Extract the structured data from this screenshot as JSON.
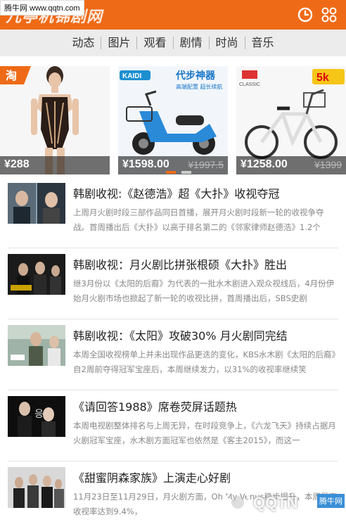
{
  "header": {
    "site_badge": "腾牛网 www.qqtn.com",
    "logo_text": "几亭机锦剧网",
    "clock_icon": "clock-icon",
    "apps_icon": "apps-grid-icon"
  },
  "nav": {
    "items": [
      "动态",
      "图片",
      "观看",
      "剧情",
      "时尚",
      "音乐"
    ]
  },
  "banner": {
    "tao_label": "淘",
    "slides": [
      {
        "price": "¥288",
        "old_price": ""
      },
      {
        "price": "¥1598.00",
        "old_price": "¥1997.5",
        "brand": "KAIDI",
        "slogan": "代步神器",
        "sub": "高端配置 超长续航"
      },
      {
        "price": "¥1258.00",
        "old_price": "¥1399",
        "brand": "CLASSIC",
        "tag": "5k"
      }
    ],
    "active_dot": 0
  },
  "articles": [
    {
      "title": "韩剧收视:《赵德浩》超《大扑》收视夺冠",
      "desc": "上周月火剧时段三部作品同日首播，展开月火剧时段新一轮的收视争夺战。首周播出后《大扑》以高于排名第二的《邻家律师赵德浩》1.2个"
    },
    {
      "title": "韩剧收视：月火剧比拼张根硕《大扑》胜出",
      "desc": "继3月份以《太阳的后裔》为代表的一批水木剧进入观众视线后，4月份伊始月火剧市场也掀起了新一轮的收视比拼，首周播出后，SBS史剧"
    },
    {
      "title": "韩剧收视：《太阳》攻破30% 月火剧同完结",
      "desc": "本周全国收视榜单上并未出现作品更迭的变化，KBS水木剧《太阳的后裔》自2周前夺得冠军宝座后，本周继续发力，以31%的收视率继续笑"
    },
    {
      "title": "《请回答1988》席卷荧屏话题热",
      "desc": "本周电视剧整体排名与上周无异，在时段竞争上，《六龙飞天》持续占据月火剧冠军宝座，水木剧方面冠军也依然是《客主2015》，而这一"
    },
    {
      "title": "《甜蜜阴森家族》上演走心好剧",
      "desc": "11月23日至11月29日，月火剧方面，Oh My Venus稳步提升，本周最高收视率达到9.4%，"
    }
  ],
  "watermark": {
    "text": "QQTN",
    "badge": "腾牛网"
  },
  "colors": {
    "brand": "#ef6a16",
    "nav_bg": "#ececec"
  }
}
